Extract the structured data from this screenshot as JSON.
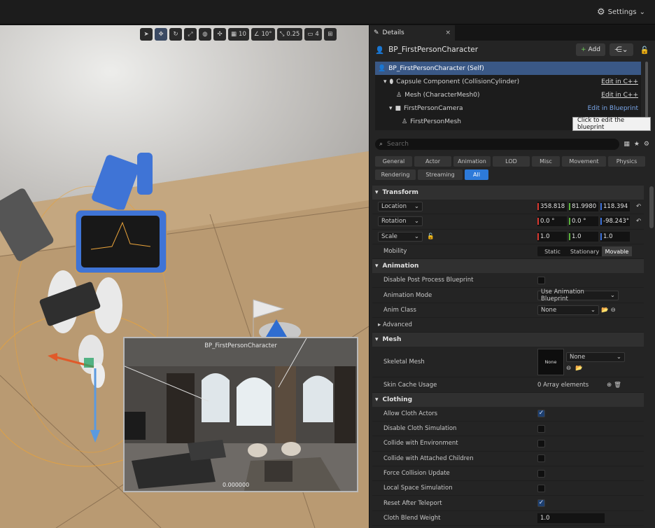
{
  "topbar": {
    "settings_label": "Settings"
  },
  "viewport": {
    "toolbar": {
      "grid_value": "10",
      "angle_value": "10°",
      "scale_value": "0.25",
      "camera_speed": "4"
    },
    "pip_title": "BP_FirstPersonCharacter",
    "pip_value": "0.000000"
  },
  "details": {
    "tab_label": "Details",
    "actor_name": "BP_FirstPersonCharacter",
    "add_label": "Add",
    "components": [
      {
        "label": "BP_FirstPersonCharacter (Self)",
        "edit": ""
      },
      {
        "label": "Capsule Component (CollisionCylinder)",
        "edit": "Edit in C++"
      },
      {
        "label": "Mesh (CharacterMesh0)",
        "edit": "Edit in C++"
      },
      {
        "label": "FirstPersonCamera",
        "edit": "Edit in Blueprint"
      },
      {
        "label": "FirstPersonMesh",
        "edit": ""
      }
    ],
    "tooltip": "Click to edit the blueprint",
    "search_placeholder": "Search",
    "filters": [
      "General",
      "Actor",
      "Animation",
      "LOD",
      "Misc",
      "Movement",
      "Physics",
      "Rendering",
      "Streaming",
      "All"
    ],
    "selected_filter": "All",
    "sections": {
      "transform": "Transform",
      "animation": "Animation",
      "mesh": "Mesh",
      "clothing": "Clothing"
    },
    "transform": {
      "location_label": "Location",
      "location": [
        "358.818",
        "81.9980",
        "118.394"
      ],
      "rotation_label": "Rotation",
      "rotation": [
        "0.0 °",
        "0.0 °",
        "-98.243°"
      ],
      "scale_label": "Scale",
      "scale": [
        "1.0",
        "1.0",
        "1.0"
      ],
      "mobility_label": "Mobility",
      "mobility_options": [
        "Static",
        "Stationary",
        "Movable"
      ],
      "mobility_selected": "Movable"
    },
    "animation": {
      "disable_pp_label": "Disable Post Process Blueprint",
      "mode_label": "Animation Mode",
      "mode_value": "Use Animation Blueprint",
      "class_label": "Anim Class",
      "class_value": "None",
      "advanced_label": "Advanced"
    },
    "mesh": {
      "skeletal_label": "Skeletal Mesh",
      "thumb_label": "None",
      "skeletal_value": "None",
      "skin_cache_label": "Skin Cache Usage",
      "skin_cache_value": "0 Array elements"
    },
    "clothing": [
      {
        "label": "Allow Cloth Actors",
        "checked": true
      },
      {
        "label": "Disable Cloth Simulation",
        "checked": false
      },
      {
        "label": "Collide with Environment",
        "checked": false
      },
      {
        "label": "Collide with Attached Children",
        "checked": false
      },
      {
        "label": "Force Collision Update",
        "checked": false
      },
      {
        "label": "Local Space Simulation",
        "checked": false
      },
      {
        "label": "Reset After Teleport",
        "checked": true
      }
    ],
    "cloth_blend_label": "Cloth Blend Weight",
    "cloth_blend_value": "1.0"
  }
}
